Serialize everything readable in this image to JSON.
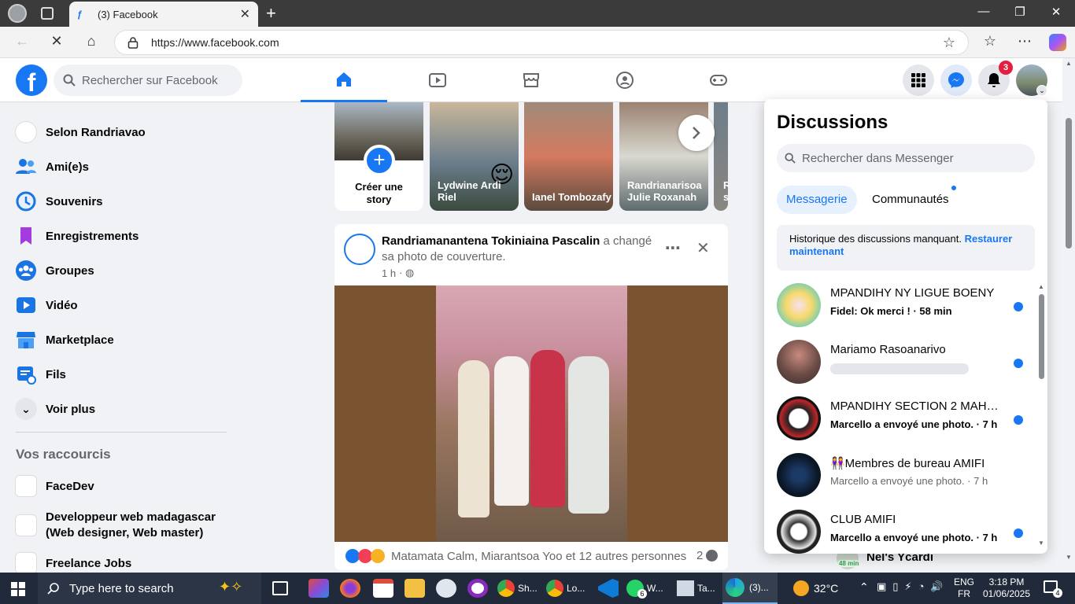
{
  "browser": {
    "tab_title": "(3) Facebook",
    "url": "https://www.facebook.com"
  },
  "header": {
    "search_placeholder": "Rechercher sur Facebook",
    "notification_count": "3"
  },
  "sidebar": {
    "items": [
      {
        "label": "Selon Randriavao",
        "icon": "profile-avatar"
      },
      {
        "label": "Ami(e)s",
        "icon": "friends-icon"
      },
      {
        "label": "Souvenirs",
        "icon": "clock-icon"
      },
      {
        "label": "Enregistrements",
        "icon": "bookmark-icon"
      },
      {
        "label": "Groupes",
        "icon": "groups-icon"
      },
      {
        "label": "Vidéo",
        "icon": "video-icon"
      },
      {
        "label": "Marketplace",
        "icon": "shop-icon"
      },
      {
        "label": "Fils",
        "icon": "feeds-icon"
      },
      {
        "label": "Voir plus",
        "icon": "chevron-down-icon"
      }
    ],
    "shortcuts_title": "Vos raccourcis",
    "shortcuts": [
      {
        "label": "FaceDev"
      },
      {
        "label": "Developpeur web madagascar (Web designer, Web master)"
      },
      {
        "label": "Freelance Jobs"
      }
    ]
  },
  "stories": [
    {
      "name": "Créer une story"
    },
    {
      "name": "Lydwine Ardi Riel"
    },
    {
      "name": "Ianel Tombozafy"
    },
    {
      "name": "Randrianarisoa Julie Roxanah"
    },
    {
      "name": "R s"
    }
  ],
  "post": {
    "author": "Randriamanantena Tokiniaina Pascalin",
    "action": "a changé sa photo de couverture.",
    "time": "1 h",
    "reactions_text": "Matamata Calm, Miarantsoa Yoo et 12 autres personnes",
    "comment_count": "2"
  },
  "messenger": {
    "title": "Discussions",
    "search_placeholder": "Rechercher dans Messenger",
    "tab_active": "Messagerie",
    "tab_other": "Communautés",
    "notice": "Historique des discussions manquant.",
    "notice_link": "Restaurer maintenant",
    "conversations": [
      {
        "name": "MPANDIHY NY LIGUE BOENY",
        "preview": "Fidel: Ok merci ! · 58 min",
        "unread": true
      },
      {
        "name": "Mariamo Rasoanarivo",
        "preview": "",
        "unread": true
      },
      {
        "name": "MPANDIHY SECTION 2 MAHA...",
        "preview": "Marcello a envoyé une photo. · 7 h",
        "unread": true
      },
      {
        "name": "👭Membres de bureau AMIFI",
        "preview": "Marcello a envoyé une photo. · 7 h",
        "unread": false
      },
      {
        "name": "CLUB AMIFI",
        "preview": "Marcello a envoyé une photo. · 7 h",
        "unread": true
      }
    ],
    "behind_contact": "Nel's Ycardi",
    "behind_time": "48 min"
  },
  "taskbar": {
    "search_placeholder": "Type here to search",
    "apps": [
      "Sh...",
      "Lo...",
      "W...",
      "Ta...",
      "(3)..."
    ],
    "whatsapp_badge": "6",
    "weather": "32°C",
    "lang1": "ENG",
    "lang2": "FR",
    "time": "3:18 PM",
    "date": "01/06/2025",
    "notif_count": "4"
  },
  "colors": {
    "accent": "#1877f2",
    "badge": "#e41e3f",
    "taskbar": "#202a3a"
  }
}
